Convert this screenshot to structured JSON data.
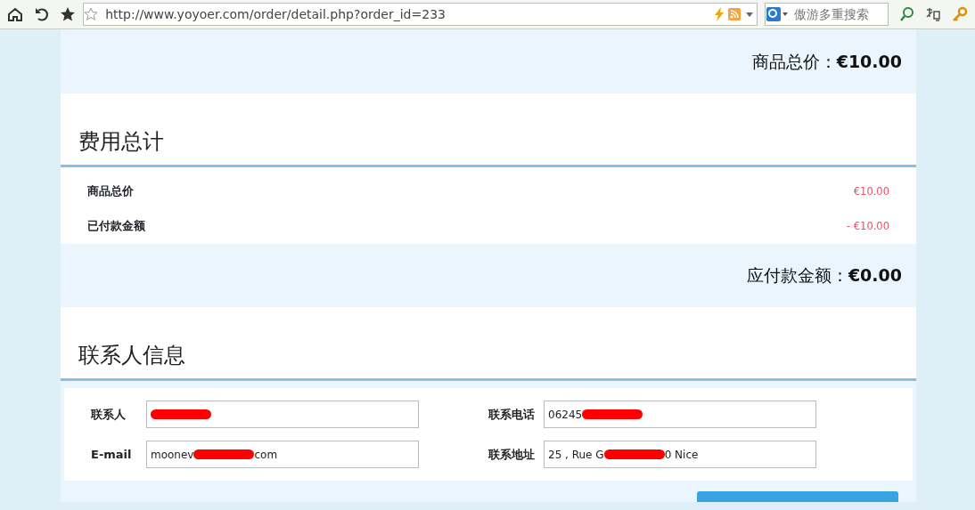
{
  "browser": {
    "url": "http://www.yoyoer.com/order/detail.php?order_id=233",
    "search_placeholder": "傲游多重搜索"
  },
  "goods_total": {
    "label": "商品总价：",
    "amount": "€10.00"
  },
  "fees": {
    "title": "费用总计",
    "rows": [
      {
        "label": "商品总价",
        "value": "€10.00"
      },
      {
        "label": "已付款金额",
        "value": "- €10.00"
      }
    ]
  },
  "amount_due": {
    "label": "应付款金额：",
    "amount": "€0.00"
  },
  "contact": {
    "title": "联系人信息",
    "fields": [
      {
        "label": "联系人",
        "redacted": true
      },
      {
        "label": "联系电话",
        "value_start": "06245",
        "redacted": true
      },
      {
        "label": "E-mail",
        "value_start": "moonev",
        "value_end": "com",
        "redacted": true
      },
      {
        "label": "联系地址",
        "value_start": "25 , Rue G",
        "value_end": "0 Nice",
        "redacted": true
      }
    ]
  }
}
